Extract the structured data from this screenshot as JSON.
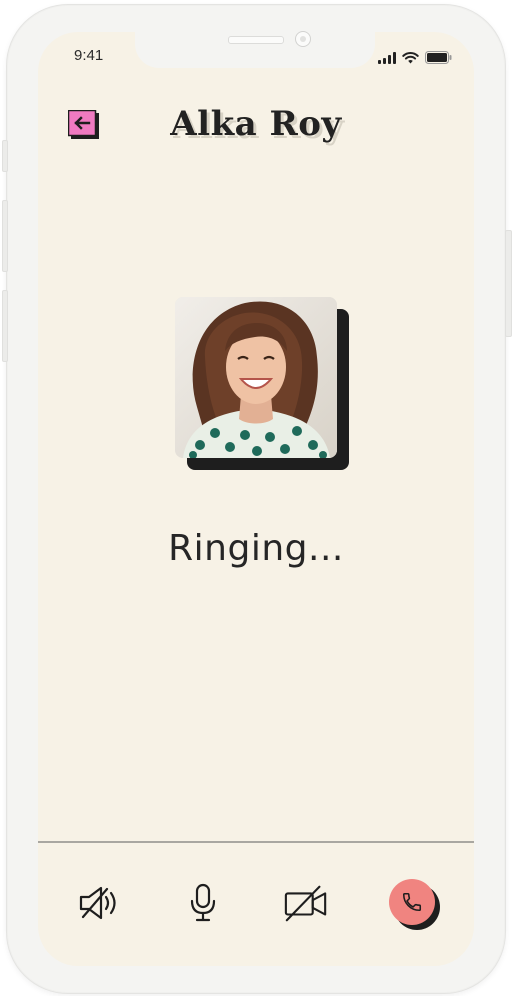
{
  "status_bar": {
    "time": "9:41"
  },
  "header": {
    "back_icon": "arrow-left-icon",
    "contact_name": "Alka Roy"
  },
  "call": {
    "status_text": "Ringing...",
    "avatar_description_icon": "contact-photo"
  },
  "controls": [
    {
      "icon": "speaker-icon"
    },
    {
      "icon": "microphone-icon"
    },
    {
      "icon": "video-off-icon"
    },
    {
      "icon": "phone-end-icon"
    }
  ],
  "colors": {
    "screen_bg": "#f7f2e6",
    "back_button": "#f07ac1",
    "end_call": "#f08480",
    "text": "#262626"
  }
}
